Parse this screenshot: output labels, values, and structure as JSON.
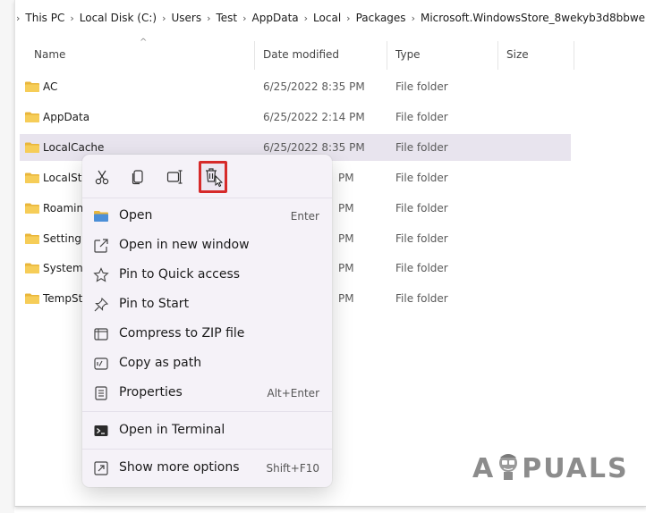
{
  "breadcrumb": {
    "items": [
      "This PC",
      "Local Disk (C:)",
      "Users",
      "Test",
      "AppData",
      "Local",
      "Packages",
      "Microsoft.WindowsStore_8wekyb3d8bbwe"
    ]
  },
  "columns": {
    "name": "Name",
    "date": "Date modified",
    "type": "Type",
    "size": "Size"
  },
  "rows": [
    {
      "name": "AC",
      "date": "6/25/2022 8:35 PM",
      "type": "File folder"
    },
    {
      "name": "AppData",
      "date": "6/25/2022 2:14 PM",
      "type": "File folder"
    },
    {
      "name": "LocalCache",
      "date": "6/25/2022 8:35 PM",
      "type": "File folder"
    },
    {
      "name": "LocalSt",
      "date": "PM",
      "type": "File folder"
    },
    {
      "name": "Roamin",
      "date": "PM",
      "type": "File folder"
    },
    {
      "name": "Setting",
      "date": "PM",
      "type": "File folder"
    },
    {
      "name": "System",
      "date": "PM",
      "type": "File folder"
    },
    {
      "name": "TempSt",
      "date": "PM",
      "type": "File folder"
    }
  ],
  "selected_row": "LocalCache",
  "context_menu": {
    "toolbar": [
      "cut-icon",
      "copy-icon",
      "rename-icon",
      "delete-icon"
    ],
    "items": [
      {
        "label": "Open",
        "shortcut": "Enter",
        "icon": "folder-icon"
      },
      {
        "label": "Open in new window",
        "shortcut": "",
        "icon": "open-new-window-icon"
      },
      {
        "label": "Pin to Quick access",
        "shortcut": "",
        "icon": "star-icon"
      },
      {
        "label": "Pin to Start",
        "shortcut": "",
        "icon": "pin-icon"
      },
      {
        "label": "Compress to ZIP file",
        "shortcut": "",
        "icon": "zip-icon"
      },
      {
        "label": "Copy as path",
        "shortcut": "",
        "icon": "copy-path-icon"
      },
      {
        "label": "Properties",
        "shortcut": "Alt+Enter",
        "icon": "properties-icon"
      },
      {
        "label": "Open in Terminal",
        "shortcut": "",
        "icon": "terminal-icon"
      },
      {
        "label": "Show more options",
        "shortcut": "Shift+F10",
        "icon": "more-options-icon"
      }
    ]
  },
  "watermark": {
    "text_a": "A",
    "text_rest": "PUALS"
  },
  "colors": {
    "folder": "#f3c44f",
    "selection": "#e8e4ee",
    "highlight_border": "#d62a2a",
    "menu_bg": "#f5f2f8"
  }
}
